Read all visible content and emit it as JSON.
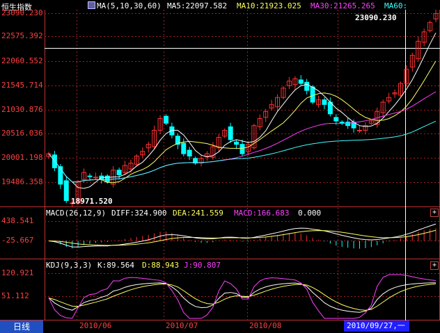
{
  "colors": {
    "background": "#000000",
    "axis": "#c03030",
    "up_candle": "#ff3030",
    "down_candle": "#00ffff",
    "ma5": "#ffffff",
    "ma10": "#ffff60",
    "ma30": "#ff40ff",
    "ma60": "#40ffff",
    "label": "#ff4040"
  },
  "header": {
    "title": "恒生指数",
    "ma_label": "MA(5,10,30,60)",
    "ma5": "MA5:22097.582",
    "ma10": "MA10:21923.025",
    "ma30": "MA30:21265.265",
    "ma60": "MA60:"
  },
  "price_axis": [
    "23090.230",
    "22575.392",
    "22060.552",
    "21545.714",
    "21030.876",
    "20516.036",
    "20001.198",
    "19486.358"
  ],
  "price_tags": {
    "high": "23090.230",
    "low": "18971.520"
  },
  "macd": {
    "label": "MACD(26,12,9)",
    "diff": "DIFF:324.900",
    "dea": "DEA:241.559",
    "macd": "MACD:166.683",
    "zero": "0.000",
    "axis": [
      "438.541",
      "-25.667"
    ]
  },
  "kdj": {
    "label": "KDJ(9,3,3)",
    "k": "K:89.564",
    "d": "D:88.943",
    "j": "J:90.807",
    "axis": [
      "120.921",
      "51.112"
    ]
  },
  "footer": {
    "tab": "日线",
    "months": [
      "2010/06",
      "2010/07",
      "2010/08"
    ],
    "cursor_date": "2010/09/27,一"
  },
  "chart_data": {
    "type": "candlestick",
    "ylim": [
      19486.358,
      23090.23
    ],
    "close": [
      20100,
      19800,
      19450,
      19100,
      19050,
      19500,
      19700,
      19620,
      19600,
      19550,
      19500,
      19750,
      19650,
      19850,
      19900,
      20050,
      20150,
      20300,
      20600,
      20850,
      20750,
      20500,
      20300,
      20100,
      20050,
      19900,
      20000,
      20100,
      20250,
      20450,
      20600,
      20400,
      20300,
      20100,
      20300,
      20700,
      20850,
      21000,
      21150,
      21300,
      21500,
      21650,
      21700,
      21600,
      21450,
      21200,
      21250,
      21150,
      20950,
      20800,
      20750,
      20700,
      20650,
      20600,
      20700,
      20800,
      21000,
      21200,
      21300,
      21400,
      21600,
      21900,
      22200,
      22500,
      22700,
      22900,
      23090
    ],
    "series": [
      {
        "name": "MA5"
      },
      {
        "name": "MA10"
      },
      {
        "name": "MA30"
      },
      {
        "name": "MA60"
      }
    ]
  }
}
